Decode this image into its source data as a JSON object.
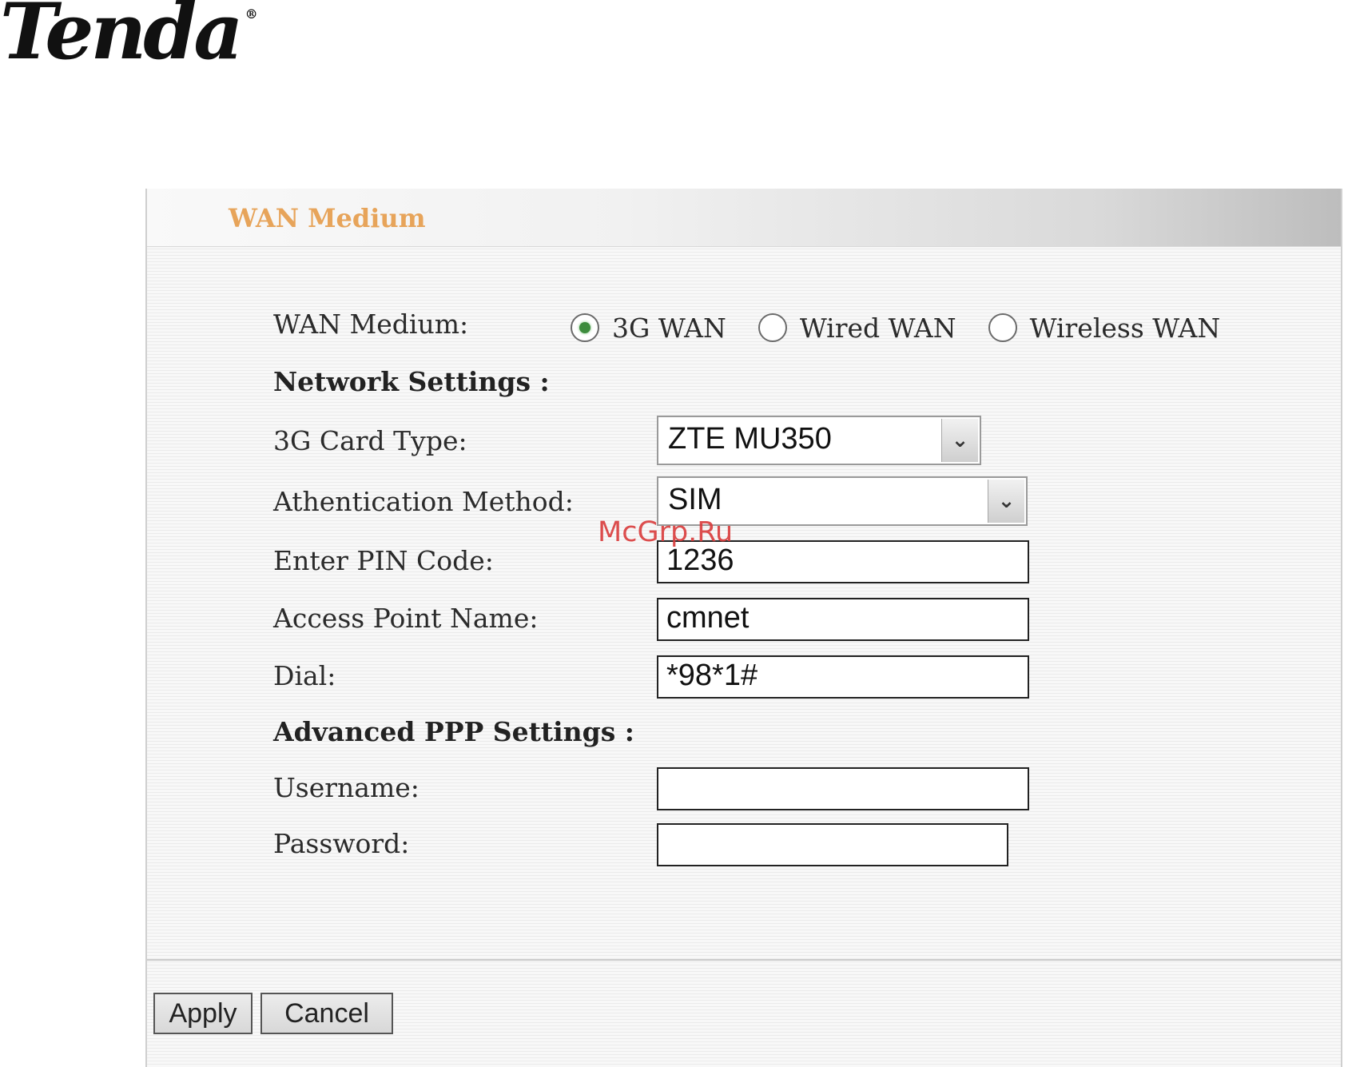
{
  "brand": {
    "logo_text": "Tenda",
    "registered_mark": "®"
  },
  "panel": {
    "title": "WAN Medium"
  },
  "wan_medium": {
    "label": "WAN Medium:",
    "options": [
      {
        "label": "3G WAN",
        "selected": true
      },
      {
        "label": "Wired WAN",
        "selected": false
      },
      {
        "label": "Wireless WAN",
        "selected": false
      }
    ]
  },
  "network_settings": {
    "heading": "Network Settings :",
    "card_type": {
      "label": "3G Card Type:",
      "value": "ZTE MU350"
    },
    "auth_method": {
      "label": "Athentication Method:",
      "value": "SIM"
    },
    "pin_code": {
      "label": "Enter PIN Code:",
      "value": "1236"
    },
    "apn": {
      "label": "Access Point Name:",
      "value": "cmnet"
    },
    "dial": {
      "label": "Dial:",
      "value": "*98*1#"
    }
  },
  "advanced_ppp": {
    "heading": "Advanced PPP Settings :",
    "username": {
      "label": "Username:",
      "value": ""
    },
    "password": {
      "label": "Password:",
      "value": ""
    }
  },
  "buttons": {
    "apply": "Apply",
    "cancel": "Cancel"
  },
  "watermark": "McGrp.Ru",
  "colors": {
    "title_accent": "#e7a45a",
    "radio_selected": "#3d8c3d",
    "watermark": "#d93b3b"
  }
}
